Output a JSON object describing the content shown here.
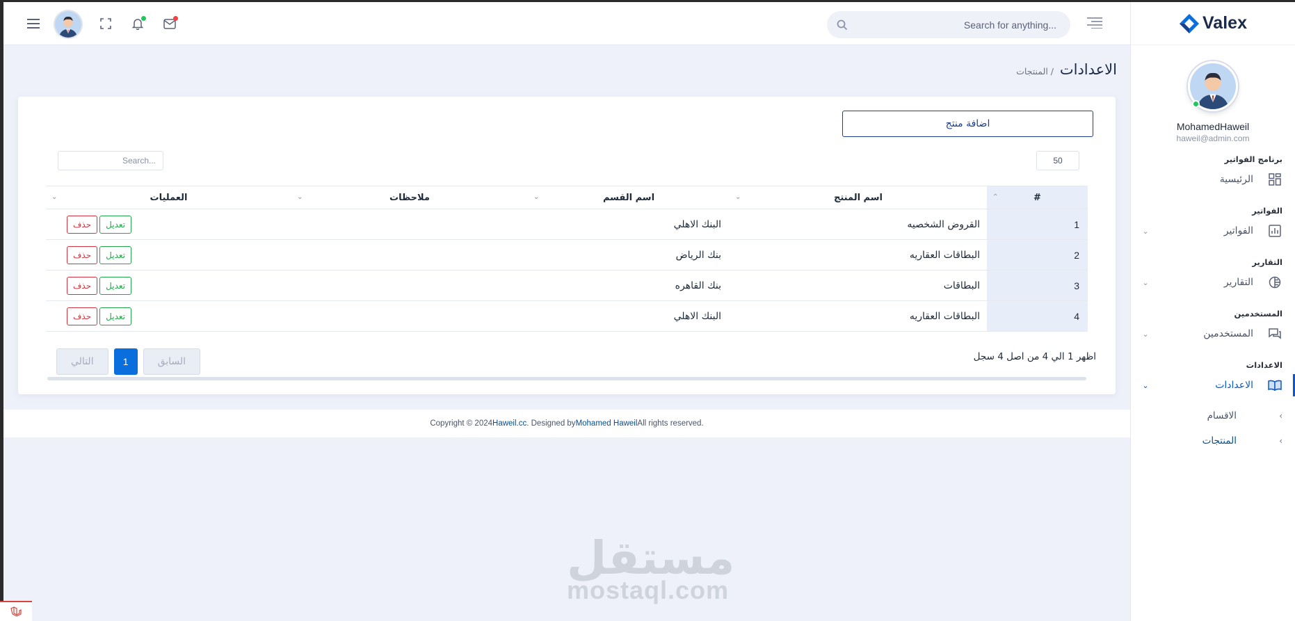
{
  "header": {
    "search_placeholder": "Search for anything...",
    "avatar_alt": "user"
  },
  "sidebar": {
    "brand": "Valex",
    "user_name": "MohamedHaweil",
    "user_email": "haweil@admin.com",
    "sections": [
      {
        "category": "برنامج الفواتير",
        "item": "الرئيسية"
      },
      {
        "category": "الفواتير",
        "item": "الفواتير"
      },
      {
        "category": "التقارير",
        "item": "التقارير"
      },
      {
        "category": "المستخدمين",
        "item": "المستخدمين"
      },
      {
        "category": "الاعدادات",
        "item": "الاعدادات"
      }
    ],
    "sub_items": [
      "الاقسام",
      "المنتجات"
    ]
  },
  "page": {
    "title": "الاعدادات",
    "breadcrumb": "/ المنتجات"
  },
  "card": {
    "add_button": "اضافة منتج",
    "page_length": "50",
    "search_placeholder": "Search..."
  },
  "table": {
    "columns": [
      "#",
      "اسم المنتج",
      "اسم القسم",
      "ملاحظات",
      "العمليات"
    ],
    "rows": [
      {
        "num": "1",
        "name": "القروض الشخصيه",
        "section": "البنك الاهلي",
        "notes": ""
      },
      {
        "num": "2",
        "name": "البطاقات العقاريه",
        "section": "بنك الرياض",
        "notes": ""
      },
      {
        "num": "3",
        "name": "البطاقات",
        "section": "بنك القاهره",
        "notes": ""
      },
      {
        "num": "4",
        "name": "البطاقات العقاريه",
        "section": "البنك الاهلي",
        "notes": ""
      }
    ],
    "edit_label": "تعديل",
    "delete_label": "حذف",
    "info": "اظهر 1 الي 4 من اصل 4 سجل",
    "prev_label": "السابق",
    "next_label": "التالي",
    "current_page": "1"
  },
  "footer": {
    "prefix": "Copyright © 2024 ",
    "site": "Haweil.cc",
    "middle": ". Designed by ",
    "author": "Mohamed Haweil",
    "suffix": " All rights reserved."
  },
  "watermark": {
    "arabic": "مستقل",
    "latin": "mostaql.com"
  },
  "colors": {
    "primary": "#0a6edc",
    "brand_dark": "#1d3f8a",
    "edit_green": "#22a849",
    "delete_red": "#d2343f",
    "page_bg": "#eef1f9"
  }
}
